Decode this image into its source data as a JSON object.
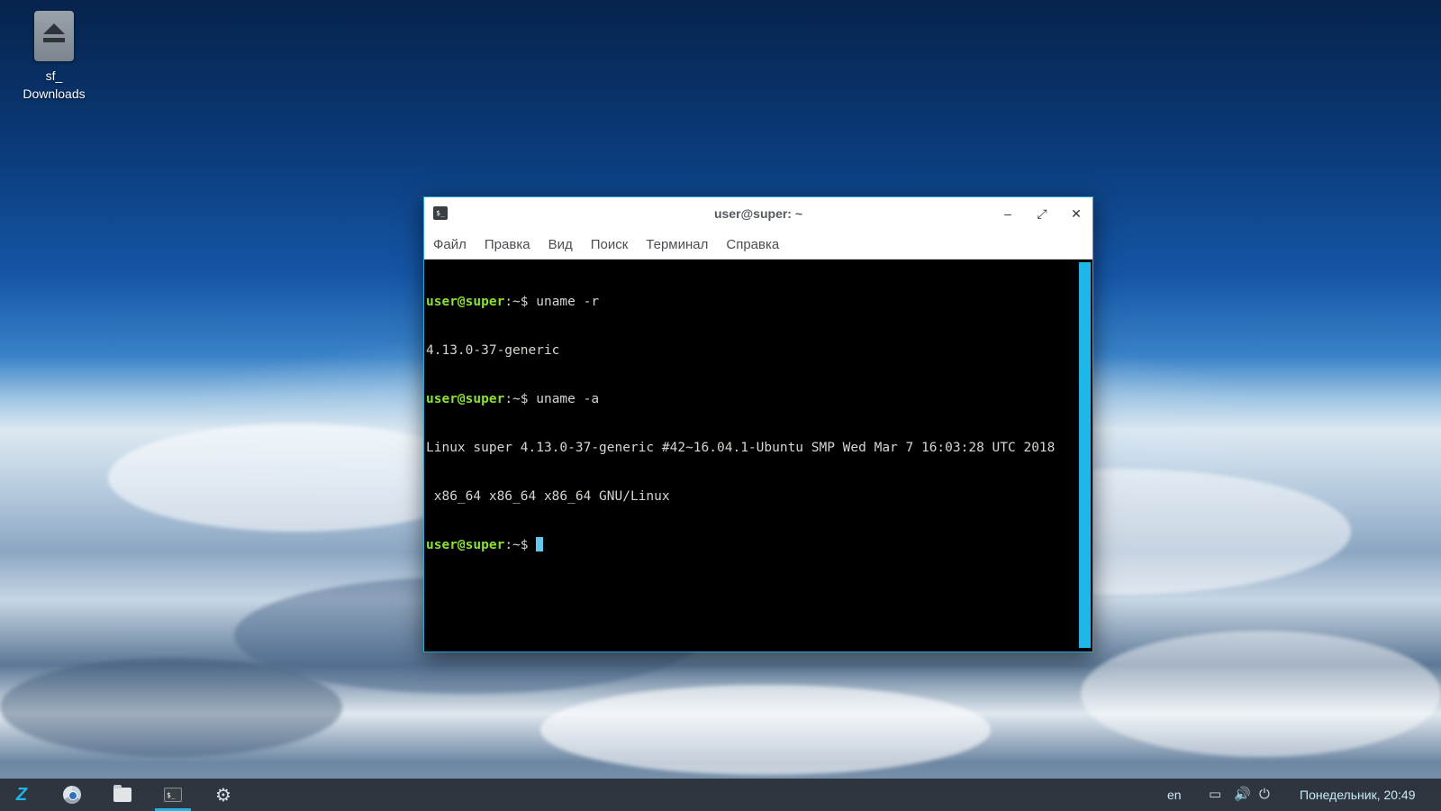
{
  "desktop": {
    "icon_label_line1": "sf_",
    "icon_label_line2": "Downloads"
  },
  "window": {
    "title": "user@super: ~",
    "app_icon_glyph": "$_",
    "controls": {
      "minimize": "–",
      "maximize": "⤢",
      "close": "✕"
    },
    "menu": [
      "Файл",
      "Правка",
      "Вид",
      "Поиск",
      "Терминал",
      "Справка"
    ]
  },
  "terminal": {
    "prompt": "user@super",
    "prompt_suffix": ":~$ ",
    "lines": [
      {
        "cmd": "uname -r"
      },
      {
        "output": "4.13.0-37-generic"
      },
      {
        "cmd": "uname -a"
      },
      {
        "output": "Linux super 4.13.0-37-generic #42~16.04.1-Ubuntu SMP Wed Mar 7 16:03:28 UTC 2018"
      },
      {
        "output": " x86_64 x86_64 x86_64 GNU/Linux"
      }
    ],
    "cursor_color": "#63c7ee",
    "prompt_color": "#8ae234",
    "scrollbar_color": "#1fb6e8"
  },
  "taskbar": {
    "apps": [
      {
        "name": "zorin-menu-icon",
        "glyph": "Z"
      },
      {
        "name": "chrome-icon"
      },
      {
        "name": "files-icon"
      },
      {
        "name": "terminal-icon",
        "glyph": "$_",
        "active": true
      },
      {
        "name": "settings-icon",
        "glyph": "⚙"
      }
    ],
    "keyboard_layout": "en",
    "tray": {
      "display": "▭",
      "volume": "🔊",
      "power": "⏻"
    },
    "clock": "Понедельник, 20:49",
    "accent_color": "#1fb6e8"
  }
}
